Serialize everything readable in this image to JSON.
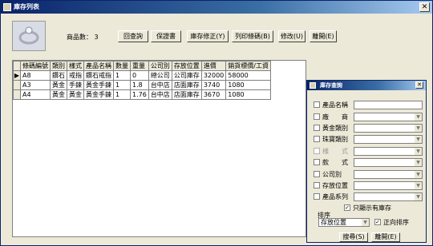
{
  "main_window": {
    "title": "庫存列表",
    "count_label": "商品數：",
    "count_value": "3",
    "buttons": [
      "回查詢",
      "保證書",
      "庫存修正(Y)",
      "列印條碼(B)",
      "修改(U)",
      "離開(E)"
    ]
  },
  "table": {
    "columns": [
      "條碼編號",
      "類別",
      "樣式",
      "產品名稱",
      "數量",
      "重量",
      "公司別",
      "存放位置",
      "進價",
      "銷貨標價/工資"
    ],
    "rows": [
      [
        "A8",
        "鑽石",
        "戒指",
        "鑽石戒指",
        "1",
        "0",
        "總公司",
        "公司庫存",
        "32000",
        "58000"
      ],
      [
        "A3",
        "黃金",
        "手鍊",
        "黃金手鍊",
        "1",
        "1.8",
        "台中店",
        "店面庫存",
        "3740",
        "1080"
      ],
      [
        "A4",
        "黃金",
        "黃金",
        "黃金手鍊",
        "1",
        "1.76",
        "台中店",
        "店面庫存",
        "3670",
        "1080"
      ]
    ]
  },
  "query_window": {
    "title": "庫存查詢",
    "fields": [
      {
        "label": "產品名稱",
        "type": "text",
        "enabled": true
      },
      {
        "label": "廠　　商",
        "type": "combo",
        "enabled": true
      },
      {
        "label": "黃金類別",
        "type": "combo",
        "enabled": true
      },
      {
        "label": "珠寶類別",
        "type": "combo",
        "enabled": true
      },
      {
        "label": "樣　　式",
        "type": "combo",
        "enabled": false
      },
      {
        "label": "款　　式",
        "type": "combo",
        "enabled": true
      },
      {
        "label": "公司別",
        "type": "combo",
        "enabled": true
      },
      {
        "label": "存放位置",
        "type": "combo",
        "enabled": true
      },
      {
        "label": "產品系列",
        "type": "combo",
        "enabled": true
      }
    ],
    "only_stock_label": "只顯示有庫存",
    "sort_label": "排序",
    "sort_value": "存放位置",
    "ascending_label": "正向排序",
    "search_button": "搜尋(S)",
    "exit_button": "離開(E)"
  }
}
